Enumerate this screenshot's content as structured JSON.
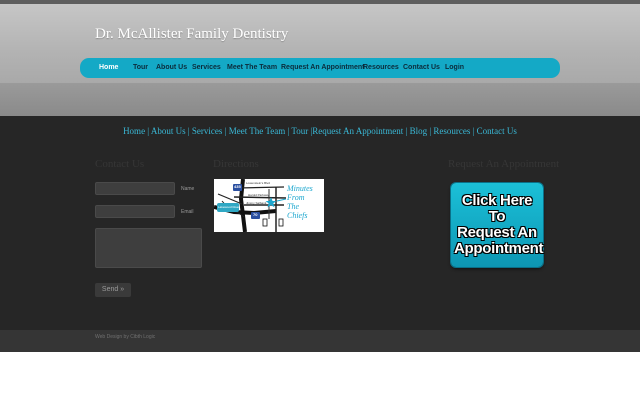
{
  "site": {
    "title": "Dr. McAllister Family Dentistry"
  },
  "nav": {
    "items": [
      {
        "label": "Home",
        "active": true
      },
      {
        "label": "Tour"
      },
      {
        "label": "About Us"
      },
      {
        "label": "Services"
      },
      {
        "label": "Meet The Team"
      },
      {
        "label": "Request An Appointment"
      },
      {
        "label": "Resources"
      },
      {
        "label": "Contact Us"
      },
      {
        "label": "Login"
      }
    ]
  },
  "quick_links": {
    "text": "Home | About Us | Services | Meet The Team | Tour |Request An Appointment | Blog | Resources | Contact Us"
  },
  "contact": {
    "title": "Contact Us",
    "name_label": "Name",
    "email_label": "Email",
    "send_label": "Send »"
  },
  "directions": {
    "title": "Directions",
    "map": {
      "highways": [
        "435",
        "70"
      ],
      "roads": [
        "Lowenstein's Blvd",
        "Harold Parkway",
        "Jimmy Salbank",
        "Lakewood Road"
      ],
      "annotation": [
        "Minutes",
        "From",
        "The",
        "Chiefs"
      ]
    }
  },
  "appointment": {
    "title": "Request An Appointment",
    "button_lines": [
      "Click Here To",
      "Request An",
      "Appointment"
    ]
  },
  "footer": {
    "credit": "Web Design by Cibth Logic"
  },
  "colors": {
    "accent": "#14a9c6",
    "link": "#3ab8d6",
    "dark_bg": "#262626"
  }
}
